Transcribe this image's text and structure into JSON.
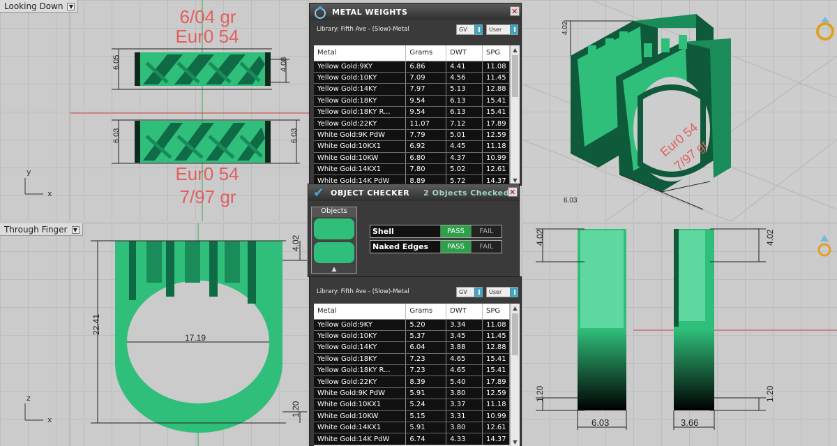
{
  "viewports": {
    "top_left": {
      "label": "Looking Down",
      "weight_top": "6/04 gr",
      "size_top": "Eur0 54",
      "size_bottom": "Eur0 54",
      "weight_bottom": "7/97 gr",
      "dims": {
        "h1": "6.05",
        "h1r": "4.08",
        "h2": "6.03",
        "h2r": "6.03"
      },
      "axis_y": "y",
      "axis_x": "x"
    },
    "bottom_left": {
      "label": "Through Finger",
      "dims": {
        "height": "22.41",
        "inner": "17.19",
        "top": "4.02",
        "bottom": "1.20"
      },
      "axis_z": "z",
      "axis_x": "x"
    },
    "top_right": {
      "dims": {
        "d1": "4.02",
        "d2": "6.03"
      },
      "size": "Eur0 54",
      "weight": "7/97 gr"
    },
    "bottom_right": {
      "dims": {
        "left_top": "4.02",
        "right_top": "4.02",
        "left_bottom": "1.20",
        "right_bottom": "1.20",
        "width1": "6.03",
        "width2": "3.66"
      }
    }
  },
  "metal_weights_1": {
    "title": "METAL WEIGHTS",
    "library": "Library: Fifth Ave - (Slow)-Metal",
    "gv": "GV",
    "user": "User",
    "columns": [
      "Metal",
      "Grams",
      "DWT",
      "SPG"
    ],
    "rows": [
      [
        "Yellow Gold:9KY",
        "6.86",
        "4.41",
        "11.08"
      ],
      [
        "Yellow Gold:10KY",
        "7.09",
        "4.56",
        "11.45"
      ],
      [
        "Yellow Gold:14KY",
        "7.97",
        "5.13",
        "12.88"
      ],
      [
        "Yellow Gold:18KY",
        "9.54",
        "6.13",
        "15.41"
      ],
      [
        "Yellow Gold:18KY R...",
        "9.54",
        "6.13",
        "15.41"
      ],
      [
        "Yellow Gold:22KY",
        "11.07",
        "7.12",
        "17.89"
      ],
      [
        "White Gold:9K PdW",
        "7.79",
        "5.01",
        "12.59"
      ],
      [
        "White Gold:10KX1",
        "6.92",
        "4.45",
        "11.18"
      ],
      [
        "White Gold:10KW",
        "6.80",
        "4.37",
        "10.99"
      ],
      [
        "White Gold:14KX1",
        "7.80",
        "5.02",
        "12.61"
      ],
      [
        "White Gold:14K PdW",
        "8.89",
        "5.72",
        "14.37"
      ]
    ]
  },
  "object_checker": {
    "title": "OBJECT CHECKER",
    "status": "2 Objects Checked",
    "objects_label": "Objects",
    "checks": [
      {
        "name": "Shell",
        "pass": "PASS",
        "fail": "FAIL"
      },
      {
        "name": "Naked Edges",
        "pass": "PASS",
        "fail": "FAIL"
      }
    ]
  },
  "metal_weights_2": {
    "library": "Library: Fifth Ave - (Slow)-Metal",
    "gv": "GV",
    "user": "User",
    "columns": [
      "Metal",
      "Grams",
      "DWT",
      "SPG"
    ],
    "rows": [
      [
        "Yellow Gold:9KY",
        "5.20",
        "3.34",
        "11.08"
      ],
      [
        "Yellow Gold:10KY",
        "5.37",
        "3.45",
        "11.45"
      ],
      [
        "Yellow Gold:14KY",
        "6.04",
        "3.88",
        "12.88"
      ],
      [
        "Yellow Gold:18KY",
        "7.23",
        "4.65",
        "15.41"
      ],
      [
        "Yellow Gold:18KY R...",
        "7.23",
        "4.65",
        "15.41"
      ],
      [
        "Yellow Gold:22KY",
        "8.39",
        "5.40",
        "17.89"
      ],
      [
        "White Gold:9K PdW",
        "5.91",
        "3.80",
        "12.59"
      ],
      [
        "White Gold:10KX1",
        "5.24",
        "3.37",
        "11.18"
      ],
      [
        "White Gold:10KW",
        "5.15",
        "3.31",
        "10.99"
      ],
      [
        "White Gold:14KX1",
        "5.91",
        "3.80",
        "12.61"
      ],
      [
        "White Gold:14K PdW",
        "6.74",
        "4.33",
        "14.37"
      ]
    ]
  },
  "colors": {
    "ring_green": "#2fbf7a",
    "ring_dark": "#0e5a3a",
    "dim_red": "#e06060",
    "pass_green": "#2ea04a"
  },
  "icons": [
    "gold-ring-icon",
    "close-icon",
    "checkmark-icon",
    "metal-weights-logo-icon",
    "chevron-down-icon"
  ]
}
